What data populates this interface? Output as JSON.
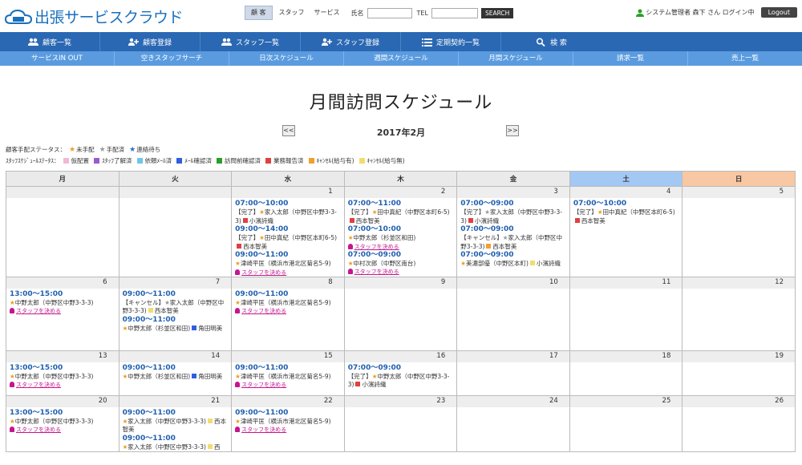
{
  "app": {
    "title": "出張サービスクラウド"
  },
  "search": {
    "tabs": [
      "顧 客",
      "スタッフ",
      "サービス"
    ],
    "name_label": "氏名",
    "tel_label": "TEL",
    "button": "SEARCH"
  },
  "user": {
    "text": "システム管理者 森下 さん ログイン中",
    "logout": "Logout"
  },
  "nav1": [
    {
      "label": "顧客一覧",
      "icon": "users-icon"
    },
    {
      "label": "顧客登録",
      "icon": "user-add-icon"
    },
    {
      "label": "スタッフ一覧",
      "icon": "users-icon"
    },
    {
      "label": "スタッフ登録",
      "icon": "user-add-icon"
    },
    {
      "label": "定期契約一覧",
      "icon": "list-icon"
    },
    {
      "label": "検 索",
      "icon": "search-icon"
    }
  ],
  "nav2": [
    "サービスIN OUT",
    "空きスタッフサーチ",
    "日次スケジュール",
    "週間スケジュール",
    "月間スケジュール",
    "請求一覧",
    "売上一覧"
  ],
  "page": {
    "title": "月間訪問スケジュール",
    "month": "2017年2月",
    "prev": "<<",
    "next": ">>"
  },
  "legend1": {
    "title": "顧客手配ステータス：",
    "items": [
      {
        "label": "未手配",
        "color": "#e8a020"
      },
      {
        "label": "手配済",
        "color": "#999999"
      },
      {
        "label": "連絡待ち",
        "color": "#2b6bd0"
      }
    ]
  },
  "legend2": {
    "title": "ｽﾀｯﾌｽｹｼﾞｭｰﾙｽﾃｰﾀｽ：",
    "items": [
      {
        "label": "仮配置",
        "color": "#f0b8d6"
      },
      {
        "label": "ｽﾀｯﾌ了解済",
        "color": "#9b59d0"
      },
      {
        "label": "依頼ﾒｰﾙ済",
        "color": "#6ec6e6"
      },
      {
        "label": "ﾒｰﾙ確認済",
        "color": "#2f5fe0"
      },
      {
        "label": "訪問前確認済",
        "color": "#2aa02a"
      },
      {
        "label": "業務報告済",
        "color": "#e04040"
      },
      {
        "label": "ｷｬﾝｾﾙ(給与有)",
        "color": "#f0a030"
      },
      {
        "label": "ｷｬﾝｾﾙ(給与無)",
        "color": "#f2dc70"
      }
    ]
  },
  "weekdays": [
    "月",
    "火",
    "水",
    "木",
    "金",
    "土",
    "日"
  ],
  "staff_link": "スタッフを決める",
  "weeks": [
    [
      {
        "day": "",
        "events": []
      },
      {
        "day": "",
        "events": []
      },
      {
        "day": "1",
        "events": [
          {
            "time": "07:00～10:00",
            "prefix": "【完了】",
            "star": "o",
            "text": "家入太郎（中野区中野3-3-3)",
            "staff": "小濱詩織",
            "scolor": "#e04040"
          },
          {
            "time": "09:00～14:00",
            "prefix": "【完了】",
            "star": "o",
            "text": "田中真紀（中野区本町6-5)",
            "staff": "西本智美",
            "scolor": "#e04040"
          },
          {
            "time": "09:00～11:00",
            "prefix": "",
            "star": "o",
            "text": "津崎平匡（横浜市港北区菊名5-9)",
            "link": true
          }
        ]
      },
      {
        "day": "2",
        "events": [
          {
            "time": "07:00～11:00",
            "prefix": "【完了】",
            "star": "o",
            "text": "田中真紀（中野区本町6-5)",
            "staff": "西本智美",
            "scolor": "#e04040"
          },
          {
            "time": "07:00～10:00",
            "prefix": "",
            "star": "o",
            "text": "中野太郎（杉並区和田)",
            "link": true
          },
          {
            "time": "07:00～09:00",
            "prefix": "",
            "star": "o",
            "text": "中村次郎（中野区南台)",
            "link": true
          }
        ]
      },
      {
        "day": "3",
        "events": [
          {
            "time": "07:00～09:00",
            "prefix": "【完了】",
            "star": "g",
            "text": "家入太郎（中野区中野3-3-3)",
            "staff": "小濱詩織",
            "scolor": "#e04040"
          },
          {
            "time": "07:00～09:00",
            "prefix": "【キャンセル】",
            "star": "g",
            "text": "家入太郎（中野区中野3-3-3)",
            "staff": "西本智美",
            "scolor": "#f0a030"
          },
          {
            "time": "07:00～09:00",
            "prefix": "",
            "star": "o",
            "text": "美濃部優（中野区本町)",
            "staff": "小濱詩織",
            "scolor": "#f2dc70"
          }
        ]
      },
      {
        "day": "4",
        "events": [
          {
            "time": "07:00～10:00",
            "prefix": "【完了】",
            "star": "o",
            "text": "田中真紀（中野区本町6-5)",
            "staff": "西本智美",
            "scolor": "#e04040"
          }
        ]
      },
      {
        "day": "5",
        "events": []
      }
    ],
    [
      {
        "day": "6",
        "events": [
          {
            "time": "13:00～15:00",
            "prefix": "",
            "star": "o",
            "text": "中野太郎（中野区中野3-3-3)",
            "link": true
          }
        ]
      },
      {
        "day": "7",
        "events": [
          {
            "time": "09:00～11:00",
            "prefix": "【キャンセル】",
            "star": "g",
            "text": "家入太郎（中野区中野3-3-3)",
            "staff": "西本智美",
            "scolor": "#f2dc70"
          },
          {
            "time": "09:00～11:00",
            "prefix": "",
            "star": "o",
            "text": "中野太郎（杉並区和田)",
            "staff": "角田明美",
            "scolor": "#2f5fe0"
          }
        ]
      },
      {
        "day": "8",
        "events": [
          {
            "time": "09:00～11:00",
            "prefix": "",
            "star": "o",
            "text": "津崎平匡（横浜市港北区菊名5-9)",
            "link": true
          }
        ]
      },
      {
        "day": "9",
        "events": []
      },
      {
        "day": "10",
        "events": []
      },
      {
        "day": "11",
        "events": []
      },
      {
        "day": "12",
        "events": []
      }
    ],
    [
      {
        "day": "13",
        "events": [
          {
            "time": "13:00～15:00",
            "prefix": "",
            "star": "o",
            "text": "中野太郎（中野区中野3-3-3)",
            "link": true
          }
        ]
      },
      {
        "day": "14",
        "events": [
          {
            "time": "09:00～11:00",
            "prefix": "",
            "star": "o",
            "text": "中野太郎（杉並区和田)",
            "staff": "角田明美",
            "scolor": "#2f5fe0"
          }
        ]
      },
      {
        "day": "15",
        "events": [
          {
            "time": "09:00～11:00",
            "prefix": "",
            "star": "o",
            "text": "津崎平匡（横浜市港北区菊名5-9)",
            "link": true
          }
        ]
      },
      {
        "day": "16",
        "events": [
          {
            "time": "07:00～09:00",
            "prefix": "【完了】",
            "star": "o",
            "text": "中野太郎（中野区中野3-3-3)",
            "staff": "小濱詩織",
            "scolor": "#e04040"
          }
        ]
      },
      {
        "day": "17",
        "events": []
      },
      {
        "day": "18",
        "events": []
      },
      {
        "day": "19",
        "events": []
      }
    ],
    [
      {
        "day": "20",
        "events": [
          {
            "time": "13:00～15:00",
            "prefix": "",
            "star": "o",
            "text": "中野太郎（中野区中野3-3-3)",
            "link": true
          }
        ]
      },
      {
        "day": "21",
        "events": [
          {
            "time": "09:00～11:00",
            "prefix": "",
            "star": "o",
            "text": "家入太郎（中野区中野3-3-3)",
            "staff": "西本智美",
            "scolor": "#f2dc70"
          },
          {
            "time": "09:00～11:00",
            "prefix": "",
            "star": "o",
            "text": "家入太郎（中野区中野3-3-3)",
            "staff": "西",
            "scolor": "#f2dc70"
          }
        ]
      },
      {
        "day": "22",
        "events": [
          {
            "time": "09:00～11:00",
            "prefix": "",
            "star": "o",
            "text": "津崎平匡（横浜市港北区菊名5-9)",
            "link": true
          }
        ]
      },
      {
        "day": "23",
        "events": []
      },
      {
        "day": "24",
        "events": []
      },
      {
        "day": "25",
        "events": []
      },
      {
        "day": "26",
        "events": []
      }
    ]
  ]
}
